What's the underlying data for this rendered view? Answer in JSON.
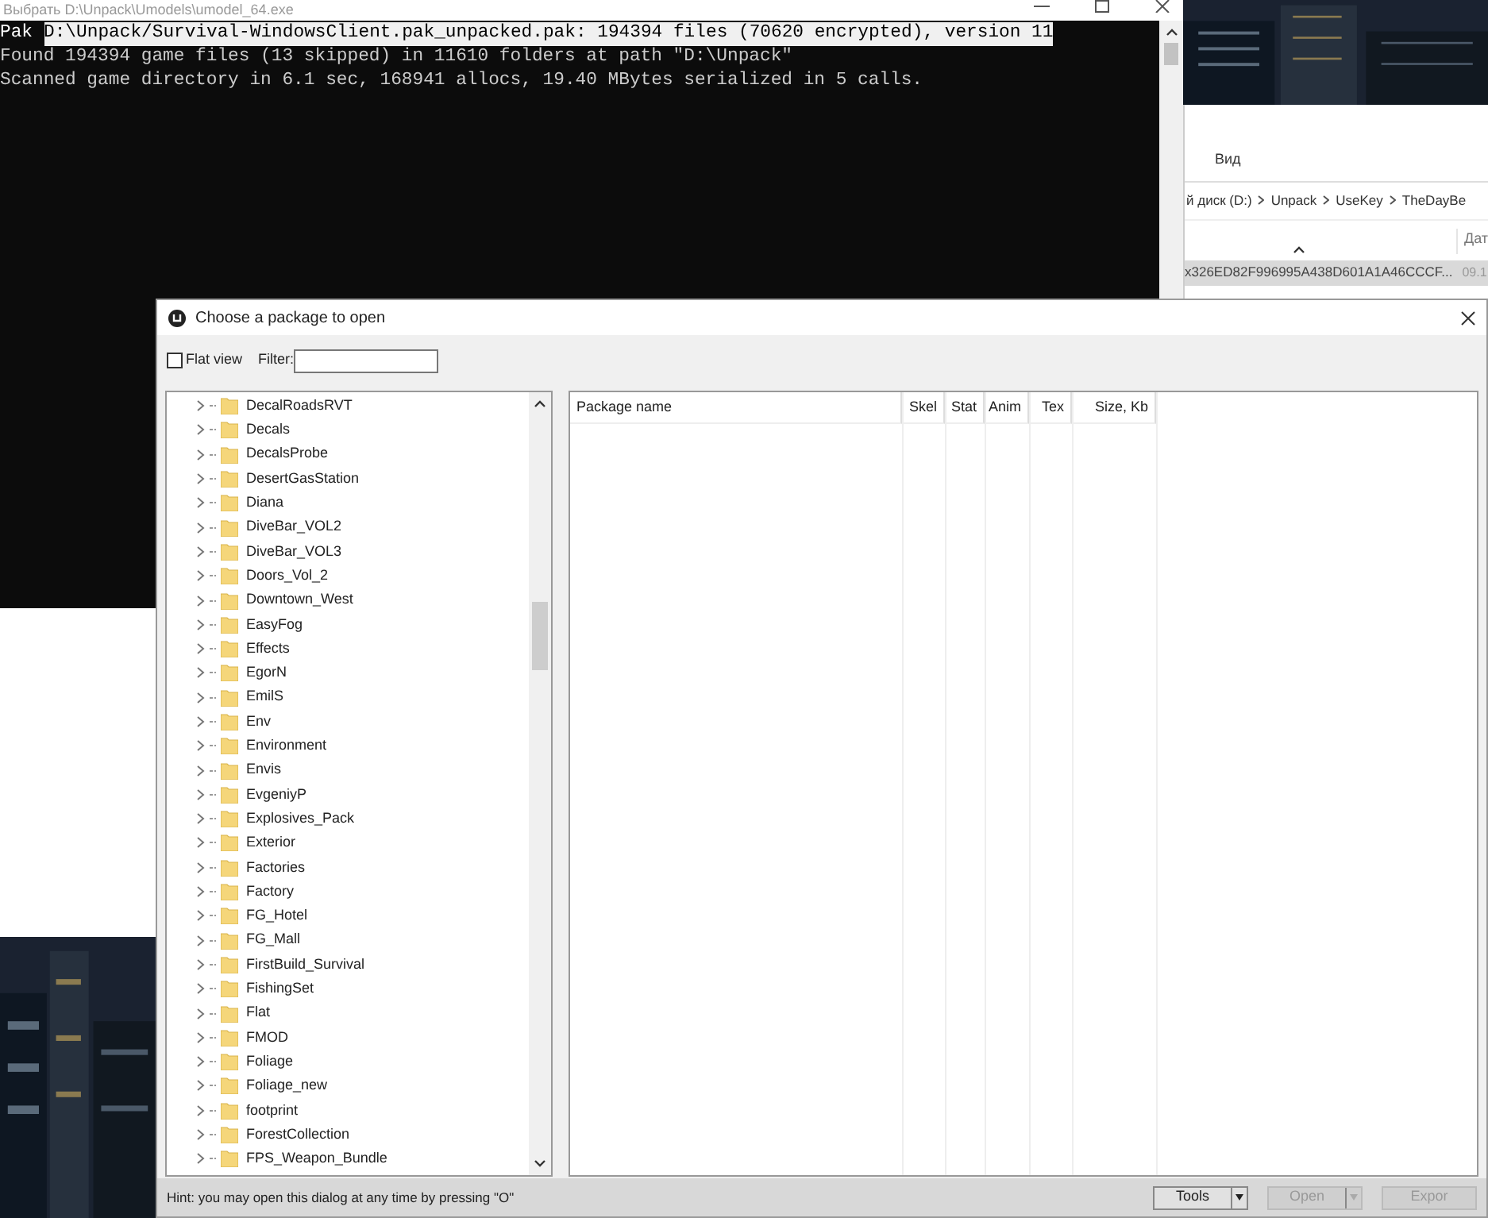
{
  "console": {
    "title": "Выбрать D:\\Unpack\\Umodels\\umodel_64.exe",
    "lines": [
      {
        "prefix": "Pak",
        "text": "D:\\Unpack/Survival-WindowsClient.pak_unpacked.pak: 194394 files (70620 encrypted), version 11",
        "selected": true
      },
      {
        "text": "Found 194394 game files (13 skipped) in 11610 folders at path \"D:\\Unpack\"",
        "selected": false
      },
      {
        "text": "Scanned game directory in 6.1 sec, 168941 allocs, 19.40 MBytes serialized in 5 calls.",
        "selected": false
      }
    ]
  },
  "explorer": {
    "menu": "Вид",
    "breadcrumb": [
      "й диск (D:)",
      "Unpack",
      "UseKey",
      "TheDayBe"
    ],
    "columns": [
      "Дат"
    ],
    "row": {
      "name": "x326ED82F996995A438D601A1A46CCCF...",
      "date": "09.1"
    }
  },
  "dialog": {
    "title": "Choose a package to open",
    "flat_view": {
      "label": "Flat view",
      "checked": false
    },
    "filter": {
      "label": "Filter:"
    },
    "tree": [
      {
        "label": "DecalRoadsRVT"
      },
      {
        "label": "Decals"
      },
      {
        "label": "DecalsProbe"
      },
      {
        "label": "DesertGasStation"
      },
      {
        "label": "Diana"
      },
      {
        "label": "DiveBar_VOL2"
      },
      {
        "label": "DiveBar_VOL3"
      },
      {
        "label": "Doors_Vol_2"
      },
      {
        "label": "Downtown_West"
      },
      {
        "label": "EasyFog"
      },
      {
        "label": "Effects"
      },
      {
        "label": "EgorN"
      },
      {
        "label": "EmilS"
      },
      {
        "label": "Env"
      },
      {
        "label": "Environment"
      },
      {
        "label": "Envis"
      },
      {
        "label": "EvgeniyP"
      },
      {
        "label": "Explosives_Pack"
      },
      {
        "label": "Exterior"
      },
      {
        "label": "Factories"
      },
      {
        "label": "Factory"
      },
      {
        "label": "FG_Hotel"
      },
      {
        "label": "FG_Mall"
      },
      {
        "label": "FirstBuild_Survival"
      },
      {
        "label": "FishingSet"
      },
      {
        "label": "Flat"
      },
      {
        "label": "FMOD"
      },
      {
        "label": "Foliage"
      },
      {
        "label": "Foliage_new"
      },
      {
        "label": "footprint"
      },
      {
        "label": "ForestCollection"
      },
      {
        "label": "FPS_Weapon_Bundle"
      }
    ],
    "columns": [
      "Package name",
      "Skel",
      "Stat",
      "Anim",
      "Tex",
      "Size, Kb"
    ],
    "hint": "Hint: you may open this dialog at any time by pressing \"O\"",
    "buttons": [
      {
        "label": "Tools",
        "disabled": false,
        "split": true
      },
      {
        "label": "Open",
        "disabled": true,
        "split": true
      },
      {
        "label": "Expor",
        "disabled": true,
        "split": false
      }
    ]
  }
}
